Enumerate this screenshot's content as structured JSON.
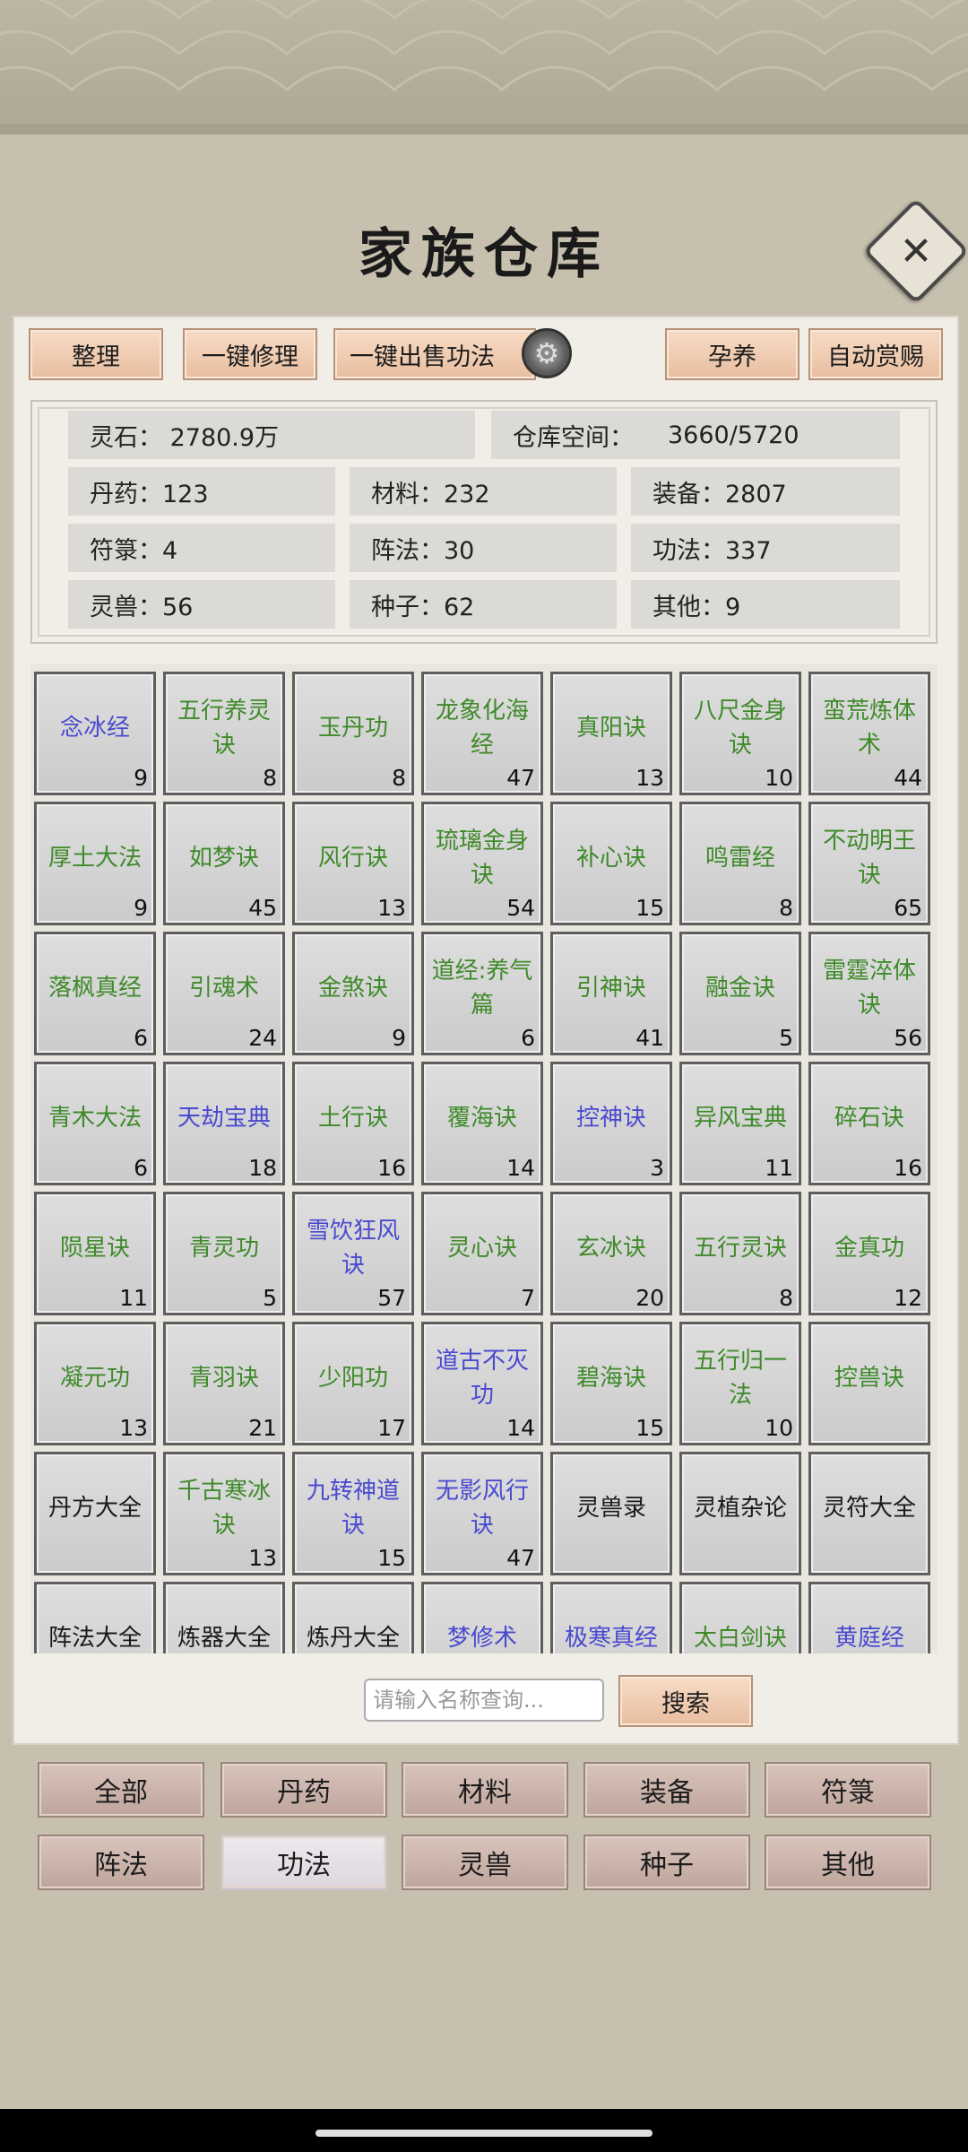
{
  "title": "家族仓库",
  "toolbar": {
    "sort": "整理",
    "repair": "一键修理",
    "sell": "一键出售功法",
    "breed": "孕养",
    "reward": "自动赏赐"
  },
  "stats": {
    "spirit_stone": "灵石：  2780.9万",
    "capacity_label": "仓库空间：",
    "capacity_value": "3660/5720",
    "pills": "丹药：123",
    "materials": "材料：232",
    "equipment": "装备：2807",
    "talismans": "符箓：4",
    "formations": "阵法：30",
    "techniques": "功法：337",
    "beasts": "灵兽：56",
    "seeds": "种子：62",
    "others": "其他：9"
  },
  "items": [
    {
      "name": "念冰经",
      "count": "9",
      "color": "blue"
    },
    {
      "name": "五行养灵诀",
      "count": "8",
      "color": "green"
    },
    {
      "name": "玉丹功",
      "count": "8",
      "color": "green"
    },
    {
      "name": "龙象化海经",
      "count": "47",
      "color": "green"
    },
    {
      "name": "真阳诀",
      "count": "13",
      "color": "green"
    },
    {
      "name": "八尺金身诀",
      "count": "10",
      "color": "green"
    },
    {
      "name": "蛮荒炼体术",
      "count": "44",
      "color": "green"
    },
    {
      "name": "厚土大法",
      "count": "9",
      "color": "green"
    },
    {
      "name": "如梦诀",
      "count": "45",
      "color": "green"
    },
    {
      "name": "风行诀",
      "count": "13",
      "color": "green"
    },
    {
      "name": "琉璃金身诀",
      "count": "54",
      "color": "green"
    },
    {
      "name": "补心诀",
      "count": "15",
      "color": "green"
    },
    {
      "name": "鸣雷经",
      "count": "8",
      "color": "green"
    },
    {
      "name": "不动明王诀",
      "count": "65",
      "color": "green"
    },
    {
      "name": "落枫真经",
      "count": "6",
      "color": "green"
    },
    {
      "name": "引魂术",
      "count": "24",
      "color": "green"
    },
    {
      "name": "金煞诀",
      "count": "9",
      "color": "green"
    },
    {
      "name": "道经:养气篇",
      "count": "6",
      "color": "green"
    },
    {
      "name": "引神诀",
      "count": "41",
      "color": "green"
    },
    {
      "name": "融金诀",
      "count": "5",
      "color": "green"
    },
    {
      "name": "雷霆淬体诀",
      "count": "56",
      "color": "green"
    },
    {
      "name": "青木大法",
      "count": "6",
      "color": "green"
    },
    {
      "name": "天劫宝典",
      "count": "18",
      "color": "blue"
    },
    {
      "name": "土行诀",
      "count": "16",
      "color": "green"
    },
    {
      "name": "覆海诀",
      "count": "14",
      "color": "green"
    },
    {
      "name": "控神诀",
      "count": "3",
      "color": "blue"
    },
    {
      "name": "异风宝典",
      "count": "11",
      "color": "green"
    },
    {
      "name": "碎石诀",
      "count": "16",
      "color": "green"
    },
    {
      "name": "陨星诀",
      "count": "11",
      "color": "green"
    },
    {
      "name": "青灵功",
      "count": "5",
      "color": "green"
    },
    {
      "name": "雪饮狂风诀",
      "count": "57",
      "color": "blue"
    },
    {
      "name": "灵心诀",
      "count": "7",
      "color": "green"
    },
    {
      "name": "玄冰诀",
      "count": "20",
      "color": "green"
    },
    {
      "name": "五行灵诀",
      "count": "8",
      "color": "green"
    },
    {
      "name": "金真功",
      "count": "12",
      "color": "green"
    },
    {
      "name": "凝元功",
      "count": "13",
      "color": "green"
    },
    {
      "name": "青羽诀",
      "count": "21",
      "color": "green"
    },
    {
      "name": "少阳功",
      "count": "17",
      "color": "green"
    },
    {
      "name": "道古不灭功",
      "count": "14",
      "color": "blue"
    },
    {
      "name": "碧海诀",
      "count": "15",
      "color": "green"
    },
    {
      "name": "五行归一法",
      "count": "10",
      "color": "green"
    },
    {
      "name": "控兽诀",
      "count": "",
      "color": "green"
    },
    {
      "name": "丹方大全",
      "count": "",
      "color": "black"
    },
    {
      "name": "千古寒冰诀",
      "count": "13",
      "color": "green"
    },
    {
      "name": "九转神道诀",
      "count": "15",
      "color": "blue"
    },
    {
      "name": "无影风行诀",
      "count": "47",
      "color": "blue"
    },
    {
      "name": "灵兽录",
      "count": "",
      "color": "black"
    },
    {
      "name": "灵植杂论",
      "count": "",
      "color": "black"
    },
    {
      "name": "灵符大全",
      "count": "",
      "color": "black"
    },
    {
      "name": "阵法大全",
      "count": "",
      "color": "black"
    },
    {
      "name": "炼器大全",
      "count": "",
      "color": "black"
    },
    {
      "name": "炼丹大全",
      "count": "",
      "color": "black"
    },
    {
      "name": "梦修术",
      "count": "",
      "color": "blue"
    },
    {
      "name": "极寒真经",
      "count": "",
      "color": "blue"
    },
    {
      "name": "太白剑诀",
      "count": "",
      "color": "green"
    },
    {
      "name": "黄庭经",
      "count": "",
      "color": "blue"
    }
  ],
  "search": {
    "placeholder": "请输入名称查询...",
    "button": "搜索"
  },
  "tabs": [
    "全部",
    "丹药",
    "材料",
    "装备",
    "符箓",
    "阵法",
    "功法",
    "灵兽",
    "种子",
    "其他"
  ],
  "active_tab": "功法",
  "colors": {
    "green_text": "#3f8a2a",
    "blue_text": "#4a4ad0",
    "button_peach": "#e8bea0",
    "tab_mauve": "#bfa59c"
  }
}
